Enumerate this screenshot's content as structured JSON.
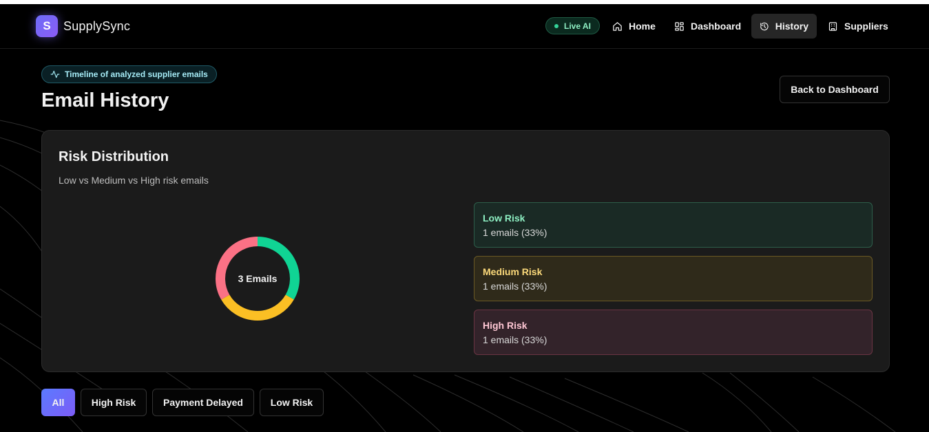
{
  "brand": {
    "logo_letter": "S",
    "name": "SupplySync"
  },
  "nav": {
    "live_label": "Live AI",
    "items": [
      {
        "label": "Home",
        "icon": "home-icon"
      },
      {
        "label": "Dashboard",
        "icon": "grid-icon"
      },
      {
        "label": "History",
        "icon": "history-icon",
        "active": true
      },
      {
        "label": "Suppliers",
        "icon": "building-icon"
      }
    ]
  },
  "header": {
    "pill": "Timeline of analyzed supplier emails",
    "title": "Email History",
    "back_button": "Back to Dashboard"
  },
  "risk_card": {
    "title": "Risk Distribution",
    "subtitle": "Low vs Medium vs High risk emails",
    "center_label": "3 Emails",
    "items": [
      {
        "label": "Low Risk",
        "count_text": "1 emails (33%)",
        "color": "#10d494"
      },
      {
        "label": "Medium Risk",
        "count_text": "1 emails (33%)",
        "color": "#fbbf24"
      },
      {
        "label": "High Risk",
        "count_text": "1 emails (33%)",
        "color": "#fb7185"
      }
    ]
  },
  "chart_data": {
    "type": "pie",
    "categories": [
      "Low Risk",
      "Medium Risk",
      "High Risk"
    ],
    "values": [
      1,
      1,
      1
    ],
    "colors": [
      "#10d494",
      "#fbbf24",
      "#fb7185"
    ]
  },
  "filters": [
    {
      "label": "All",
      "active": true
    },
    {
      "label": "High Risk"
    },
    {
      "label": "Payment Delayed"
    },
    {
      "label": "Low Risk"
    }
  ]
}
